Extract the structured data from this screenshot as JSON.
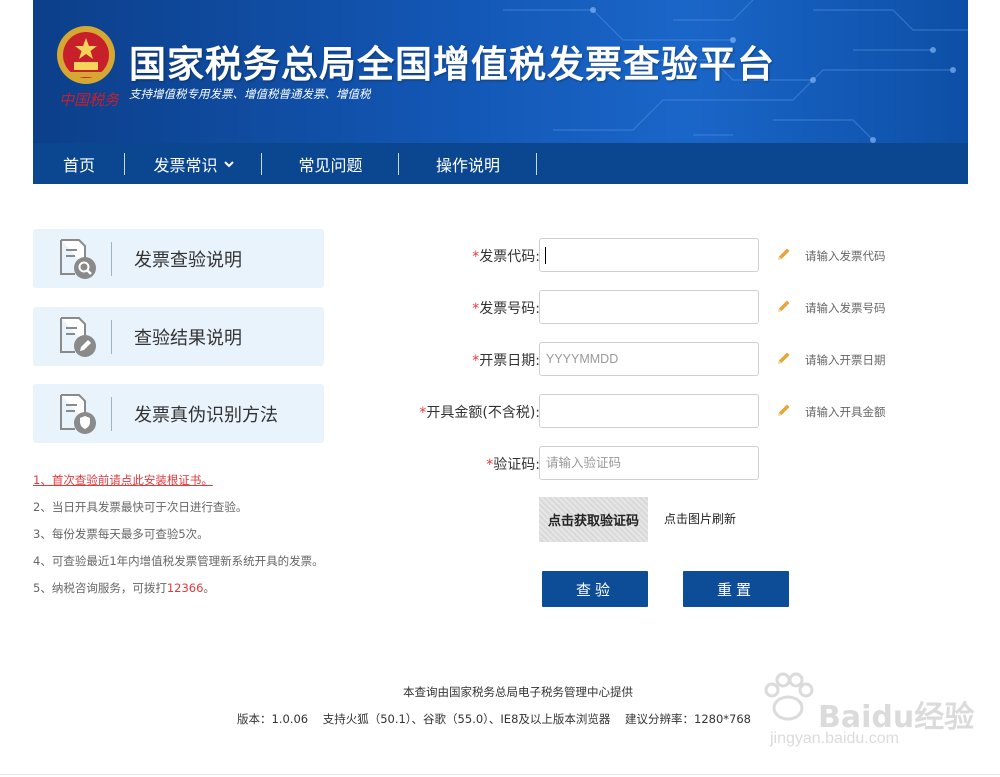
{
  "header": {
    "title": "国家税务总局全国增值税发票查验平台",
    "subtitle": "支持增值税专用发票、增值税普通发票、增值税",
    "seal_text": "中国税务"
  },
  "nav": {
    "items": [
      {
        "label": "首页"
      },
      {
        "label": "发票常识",
        "has_dropdown": true
      },
      {
        "label": "常见问题"
      },
      {
        "label": "操作说明"
      }
    ]
  },
  "side_menu": [
    {
      "label": "发票查验说明",
      "icon": "doc-search-icon"
    },
    {
      "label": "查验结果说明",
      "icon": "doc-edit-icon"
    },
    {
      "label": "发票真伪识别方法",
      "icon": "doc-shield-icon"
    }
  ],
  "notes": {
    "n1": "1、首次查验前请点此安装根证书。",
    "n2": "2、当日开具发票最快可于次日进行查验。",
    "n3": "3、每份发票每天最多可查验5次。",
    "n4": "4、可查验最近1年内增值税发票管理新系统开具的发票。",
    "n5_prefix": "5、纳税咨询服务，可拨打",
    "n5_phone": "12366",
    "n5_suffix": "。"
  },
  "form": {
    "invoice_code": {
      "label": "发票代码:",
      "value": "",
      "hint": "请输入发票代码"
    },
    "invoice_number": {
      "label": "发票号码:",
      "value": "",
      "hint": "请输入发票号码"
    },
    "issue_date": {
      "label": "开票日期:",
      "placeholder": "YYYYMMDD",
      "hint": "请输入开票日期"
    },
    "amount": {
      "label": "开具金额(不含税):",
      "value": "",
      "hint": "请输入开具金额"
    },
    "captcha": {
      "label": "验证码:",
      "placeholder": "请输入验证码"
    },
    "captcha_image_text": "点击获取验证码",
    "refresh_text": "点击图片刷新",
    "submit_label": "查验",
    "reset_label": "重置",
    "required_mark": "*"
  },
  "footer": {
    "provider": "本查询由国家税务总局电子税务管理中心提供",
    "version": "版本：1.0.06",
    "browsers": "支持火狐（50.1）、谷歌（55.0）、IE8及以上版本浏览器",
    "resolution": "建议分辨率：1280*768"
  },
  "watermark": {
    "brand": "Baidu经验",
    "url": "jingyan.baidu.com"
  },
  "colors": {
    "nav_bg": "#0a4790",
    "button_bg": "#0d4d97",
    "required": "#e4393c",
    "card_bg": "#e9f3fb"
  }
}
